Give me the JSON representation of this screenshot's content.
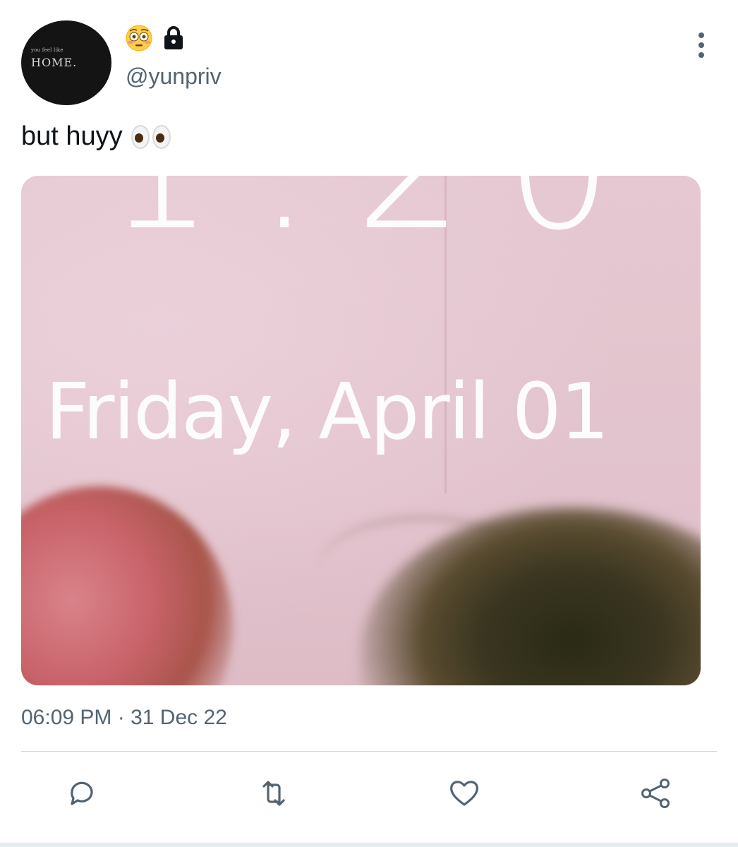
{
  "avatar": {
    "small_text": "you feel like",
    "big_text": "HOME."
  },
  "author": {
    "display_icons": [
      "flushed-face-emoji",
      "lock-icon"
    ],
    "handle": "@yunpriv"
  },
  "tweet": {
    "text": "but huyy",
    "emoji": "eyes-emoji"
  },
  "media": {
    "clock_text": "1:20",
    "date_text": "Friday, April 01"
  },
  "meta": {
    "time": "06:09 PM",
    "separator": " · ",
    "date": "31 Dec 22"
  },
  "actions": [
    "reply-icon",
    "retweet-icon",
    "like-icon",
    "share-icon"
  ],
  "colors": {
    "secondary_text": "#536471",
    "divider": "#cfd9de",
    "media_bg": "#e3c5cf"
  }
}
